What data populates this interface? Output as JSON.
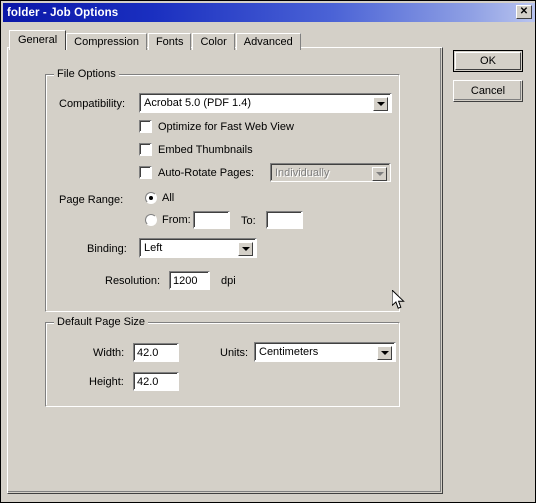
{
  "window": {
    "title": "folder - Job Options",
    "close_glyph": "✕",
    "bg_color": "#d4d0c8",
    "titlebar_color": "#0a17a8"
  },
  "tabs": [
    {
      "label": "General",
      "selected": true
    },
    {
      "label": "Compression",
      "selected": false
    },
    {
      "label": "Fonts",
      "selected": false
    },
    {
      "label": "Color",
      "selected": false
    },
    {
      "label": "Advanced",
      "selected": false
    }
  ],
  "buttons": {
    "ok": "OK",
    "cancel": "Cancel"
  },
  "file_options": {
    "group_label": "File Options",
    "compatibility_label": "Compatibility:",
    "compatibility_value": "Acrobat 5.0 (PDF 1.4)",
    "optimize_label": "Optimize for Fast Web View",
    "optimize_checked": false,
    "embed_thumbnails_label": "Embed Thumbnails",
    "embed_thumbnails_checked": false,
    "auto_rotate_label": "Auto-Rotate Pages:",
    "auto_rotate_checked": false,
    "auto_rotate_value": "Individually",
    "auto_rotate_disabled": true,
    "page_range_label": "Page Range:",
    "page_range_all_label": "All",
    "page_range_all_selected": true,
    "page_range_from_label": "From:",
    "page_range_from_value": "",
    "page_range_from_selected": false,
    "page_range_to_label": "To:",
    "page_range_to_value": "",
    "binding_label": "Binding:",
    "binding_value": "Left",
    "resolution_label": "Resolution:",
    "resolution_value": "1200",
    "resolution_units": "dpi"
  },
  "default_page_size": {
    "group_label": "Default Page Size",
    "width_label": "Width:",
    "width_value": "42.0",
    "height_label": "Height:",
    "height_value": "42.0",
    "units_label": "Units:",
    "units_value": "Centimeters"
  }
}
